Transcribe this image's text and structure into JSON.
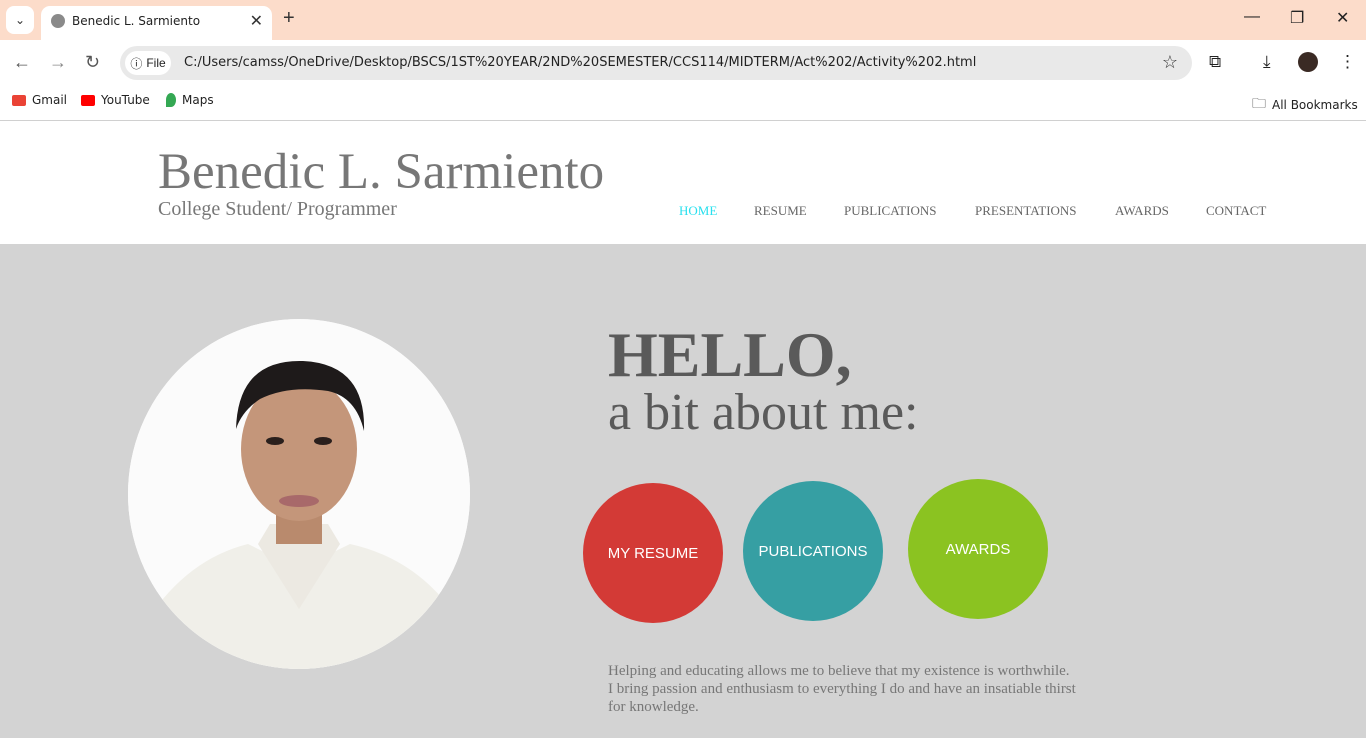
{
  "browser": {
    "tab_title": "Benedic L. Sarmiento",
    "file_chip": "File",
    "url": "C:/Users/camss/OneDrive/Desktop/BSCS/1ST%20YEAR/2ND%20SEMESTER/CCS114/MIDTERM/Act%202/Activity%202.html",
    "bookmarks": [
      {
        "label": "Gmail",
        "icon": "gmail-icon",
        "color": "#ea4335"
      },
      {
        "label": "YouTube",
        "icon": "youtube-icon",
        "color": "#ff0000"
      },
      {
        "label": "Maps",
        "icon": "maps-icon",
        "color": "#34a853"
      }
    ],
    "all_bookmarks": "All Bookmarks"
  },
  "site": {
    "name": "Benedic L. Sarmiento",
    "tagline": "College Student/ Programmer",
    "nav": [
      "HOME",
      "RESUME",
      "PUBLICATIONS",
      "PRESENTATIONS",
      "AWARDS",
      "CONTACT"
    ],
    "active_nav": "HOME"
  },
  "hero": {
    "greeting": "HELLO,",
    "subheading": "a bit about me:",
    "buttons": [
      {
        "label": "MY RESUME",
        "color": "#d33a36"
      },
      {
        "label": "PUBLICATIONS",
        "color": "#369fa3"
      },
      {
        "label": "AWARDS",
        "color": "#8bc321"
      }
    ],
    "bio": "Helping and educating allows me to believe that my existence is worthwhile. I bring passion and enthusiasm to everything I do and have an insatiable thirst for knowledge."
  },
  "colors": {
    "tabstrip": "#fcdcca",
    "page_bg": "#d3d3d3",
    "nav_active": "#28e0ee"
  }
}
